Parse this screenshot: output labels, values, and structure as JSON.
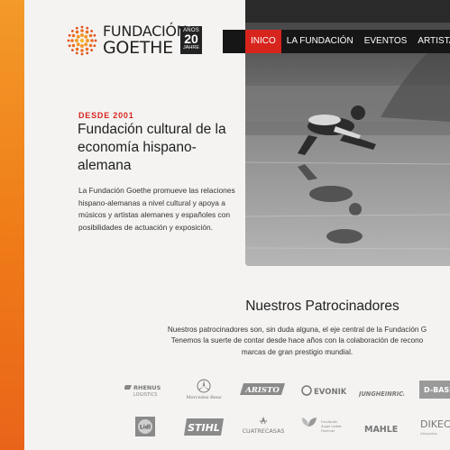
{
  "brand": {
    "name_line1": "FUNDACIÓN",
    "name_line2": "GOETHE",
    "badge_top": "AÑOS",
    "badge_number": "20",
    "badge_bottom": "JAHRE",
    "accent_color": "#d7241d",
    "side_bar_color": "#ef7a17"
  },
  "nav": {
    "items": [
      "INICO",
      "LA FUNDACIÓN",
      "EVENTOS",
      "ARTISTAS"
    ],
    "active": "INICO"
  },
  "intro": {
    "eyebrow": "DESDE 2001",
    "headline": "Fundación cultural de la economía hispano-alemana",
    "body": "La Fundación Goethe promueve las relaciones hispano-alemanas a nivel cultural y apoya a músicos y artistas alemanes y españoles con posibilidades de actuación y exposición."
  },
  "sponsors": {
    "title": "Nuestros Patrocinadores",
    "text_lines": [
      "Nuestros patrocinadores son, sin duda alguna, el eje central de la Fundación G",
      "Tenemos la suerte de contar desde hace años con la colaboración de recono",
      "marcas de gran prestigio mundial."
    ],
    "logos": [
      {
        "name": "RHENUS LOGISTICS",
        "icon": "rhenus-logo"
      },
      {
        "name": "Mercedes-Benz",
        "icon": "mercedes-star-logo"
      },
      {
        "name": "ARISTO",
        "icon": "aristo-logo"
      },
      {
        "name": "EVONIK",
        "icon": "evonik-logo"
      },
      {
        "name": "JUNGHEINRICH",
        "icon": "jungheinrich-logo"
      },
      {
        "name": "BASF",
        "icon": "basf-logo"
      },
      {
        "name": "Lidl",
        "icon": "lidl-logo"
      },
      {
        "name": "STIHL",
        "icon": "stihl-logo"
      },
      {
        "name": "CUATRECASAS",
        "icon": "cuatrecasas-logo"
      },
      {
        "name": "Fundación Ángel Llobet Flechner",
        "icon": "fundacion-leaf-logo"
      },
      {
        "name": "MAHLE",
        "icon": "mahle-logo"
      },
      {
        "name": "DIKEC",
        "icon": "dikec-logo"
      }
    ]
  }
}
